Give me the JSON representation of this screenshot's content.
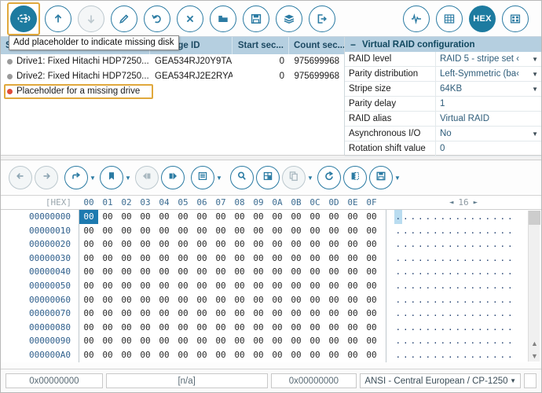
{
  "toolbar": {
    "items": [
      {
        "name": "add-placeholder-missing-disk",
        "icon": "missing-disk-icon",
        "state": "selected-filled"
      },
      {
        "name": "move-up",
        "icon": "arrow-up-icon",
        "state": "enabled"
      },
      {
        "name": "move-down",
        "icon": "arrow-down-icon",
        "state": "disabled"
      },
      {
        "name": "edit",
        "icon": "pencil-icon",
        "state": "enabled"
      },
      {
        "name": "undo",
        "icon": "undo-icon",
        "state": "enabled"
      },
      {
        "name": "remove",
        "icon": "close-x-icon",
        "state": "enabled"
      },
      {
        "name": "open",
        "icon": "folder-icon",
        "state": "enabled"
      },
      {
        "name": "save",
        "icon": "floppy-save-icon",
        "state": "enabled"
      },
      {
        "name": "layers",
        "icon": "layers-stack-icon",
        "state": "enabled"
      },
      {
        "name": "export",
        "icon": "export-arrow-icon",
        "state": "enabled"
      }
    ],
    "right_items": [
      {
        "name": "signal-analysis",
        "icon": "waveform-icon",
        "state": "enabled"
      },
      {
        "name": "disk-map",
        "icon": "grid-map-icon",
        "state": "enabled"
      },
      {
        "name": "hex-view",
        "icon": "hex-icon",
        "label": "HEX",
        "state": "active-filled"
      },
      {
        "name": "partitions",
        "icon": "partition-blocks-icon",
        "state": "enabled"
      }
    ],
    "hex_label": "HEX"
  },
  "tooltip": {
    "text": "Add placeholder to indicate missing disk"
  },
  "drives": {
    "columns": [
      "Storage name",
      "Storage ID",
      "Start sec...",
      "Count sec..."
    ],
    "rows": [
      {
        "status": "gray",
        "name": "Drive1: Fixed Hitachi HDP7250...",
        "id": "GEA534RJ20Y9TA",
        "start": "0",
        "count": "975699968"
      },
      {
        "status": "gray",
        "name": "Drive2: Fixed Hitachi HDP7250...",
        "id": "GEA534RJ2E2RYA",
        "start": "0",
        "count": "975699968"
      },
      {
        "status": "red",
        "name": "Placeholder for a missing drive",
        "id": "",
        "start": "",
        "count": ""
      }
    ]
  },
  "raid": {
    "title": "Virtual RAID configuration",
    "collapse_glyph": "−",
    "rows": [
      {
        "key": "RAID level",
        "value": "RAID 5 - stripe set ‹",
        "dropdown": true
      },
      {
        "key": "Parity distribution",
        "value": "Left-Symmetric (ba‹",
        "dropdown": true
      },
      {
        "key": "Stripe size",
        "value": "64KB",
        "dropdown": true
      },
      {
        "key": "Parity delay",
        "value": "1",
        "dropdown": false
      },
      {
        "key": "RAID alias",
        "value": "Virtual RAID",
        "dropdown": false
      },
      {
        "key": "Asynchronous I/O",
        "value": "No",
        "dropdown": true
      },
      {
        "key": "Rotation shift value",
        "value": "0",
        "dropdown": false
      }
    ]
  },
  "hextoolbar": {
    "items": [
      {
        "name": "navigate-back",
        "icon": "arrow-left-icon",
        "state": "dim",
        "caret": false
      },
      {
        "name": "navigate-forward",
        "icon": "arrow-right-icon",
        "state": "dim",
        "caret": false
      },
      {
        "name": "go-to-offset",
        "icon": "goto-arrow-icon",
        "state": "enabled",
        "caret": true
      },
      {
        "name": "bookmarks",
        "icon": "bookmark-icon",
        "state": "enabled",
        "caret": true
      },
      {
        "name": "previous-bookmark",
        "icon": "bookmark-prev-icon",
        "state": "dim",
        "caret": false
      },
      {
        "name": "next-bookmark",
        "icon": "bookmark-next-icon",
        "state": "enabled",
        "caret": false
      },
      {
        "name": "templates-list",
        "icon": "list-icon",
        "state": "enabled",
        "caret": true
      },
      {
        "name": "find",
        "icon": "search-icon",
        "state": "enabled",
        "caret": false
      },
      {
        "name": "inspector",
        "icon": "table-grid-icon",
        "state": "enabled",
        "caret": false
      },
      {
        "name": "copy",
        "icon": "copy-icon",
        "state": "dim",
        "caret": true
      },
      {
        "name": "refresh",
        "icon": "refresh-icon",
        "state": "enabled",
        "caret": false
      },
      {
        "name": "select-block",
        "icon": "select-block-icon",
        "state": "enabled",
        "caret": false
      },
      {
        "name": "save-hex",
        "icon": "floppy-save-icon",
        "state": "enabled",
        "caret": true
      }
    ]
  },
  "hexview": {
    "addr_header": "[HEX]",
    "byte_columns": [
      "00",
      "01",
      "02",
      "03",
      "04",
      "05",
      "06",
      "07",
      "08",
      "09",
      "0A",
      "0B",
      "0C",
      "0D",
      "0E",
      "0F"
    ],
    "bytes_per_row_label": "16",
    "prev_glyph": "◄",
    "next_glyph": "►",
    "addresses": [
      "00000000",
      "00000010",
      "00000020",
      "00000030",
      "00000040",
      "00000050",
      "00000060",
      "00000070",
      "00000080",
      "00000090",
      "000000A0"
    ],
    "byte_value": "00",
    "ascii_char": ".",
    "selected_cell": {
      "row": 0,
      "col": 0
    }
  },
  "statusbar": {
    "offset": "0x00000000",
    "selection": "[n/a]",
    "size": "0x00000000",
    "encoding": "ANSI - Central European / CP-1250"
  },
  "colors": {
    "accent": "#1d7ba0",
    "header_bg": "#b5cfe0",
    "highlight_border": "#e0a83c",
    "selection_bg": "#1d7ab0",
    "ascii_selection_bg": "#b9dcf0",
    "missing_drive_dot": "#e04b3a",
    "drive_dot": "#9a9a9a"
  }
}
